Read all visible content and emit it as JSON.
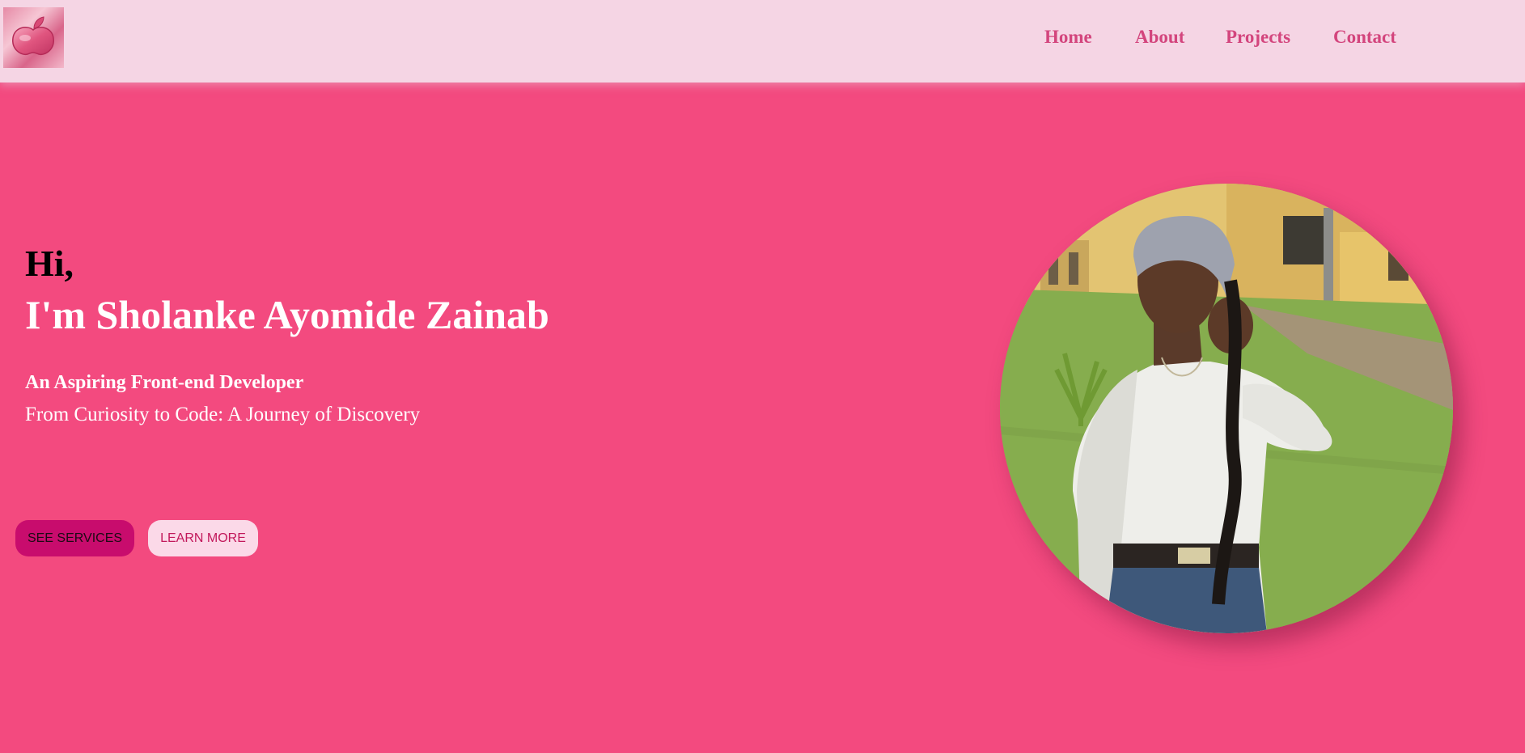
{
  "navbar": {
    "logo_icon": "apple-logo-icon",
    "links": [
      {
        "label": "Home"
      },
      {
        "label": "About"
      },
      {
        "label": "Projects"
      },
      {
        "label": "Contact"
      }
    ]
  },
  "hero": {
    "greeting": "Hi,",
    "name": "I'm Sholanke Ayomide Zainab",
    "role": "An Aspiring Front-end Developer",
    "tagline": "From Curiosity to Code: A Journey of Discovery",
    "buttons": {
      "services": "SEE SERVICES",
      "learn_more": "LEARN MORE"
    },
    "portrait_icon": "profile-photo"
  },
  "colors": {
    "background": "#f34a7f",
    "navbar": "#f5d5e4",
    "nav_link": "#d3457d",
    "primary_button": "#c80c6d",
    "secondary_button": "#fbd9e8"
  }
}
